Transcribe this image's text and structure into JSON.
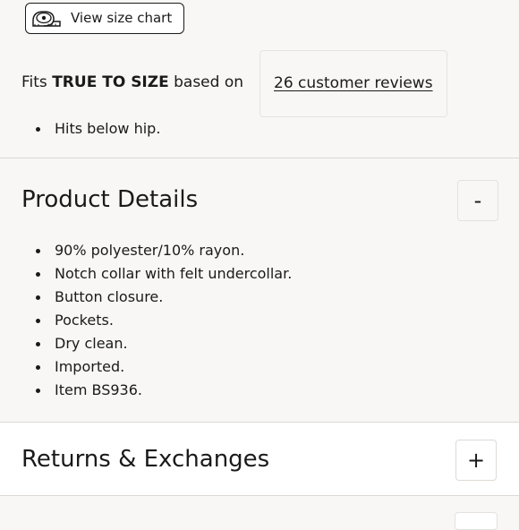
{
  "size_chart": {
    "label": "View size chart",
    "icon": "measuring-tape-icon"
  },
  "fit": {
    "prefix": "Fits",
    "emphasis": "TRUE TO SIZE",
    "middle": "based on",
    "reviews_link": "26 customer reviews",
    "bullets": [
      "Hits below hip."
    ]
  },
  "product_details": {
    "title": "Product Details",
    "toggle": "-",
    "bullets": [
      "90% polyester/10% rayon.",
      "Notch collar with felt undercollar.",
      "Button closure.",
      "Pockets.",
      "Dry clean.",
      "Imported.",
      "Item BS936."
    ]
  },
  "returns": {
    "title": "Returns & Exchanges",
    "toggle": "+"
  }
}
